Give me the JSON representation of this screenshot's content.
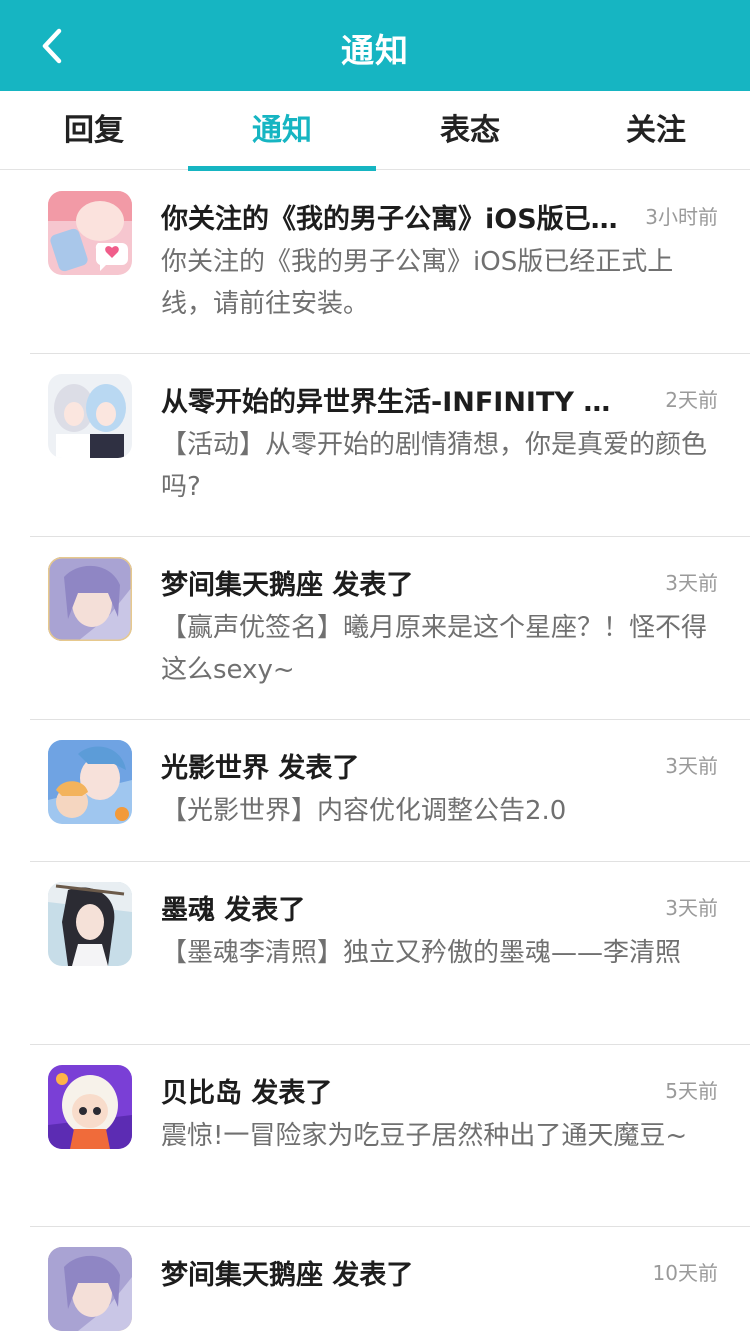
{
  "header": {
    "title": "通知"
  },
  "tabs": [
    {
      "label": "回复"
    },
    {
      "label": "通知"
    },
    {
      "label": "表态"
    },
    {
      "label": "关注"
    }
  ],
  "notifications": [
    {
      "title": "你关注的《我的男子公寓》iOS版已经正式上线",
      "time": "3小时前",
      "body": "你关注的《我的男子公寓》iOS版已经正式上线，请前往安装。"
    },
    {
      "title": "从零开始的异世界生活-INFINITY 发表了",
      "time": "2天前",
      "body": "【活动】从零开始的剧情猜想，你是真爱的颜色吗?"
    },
    {
      "title": "梦间集天鹅座 发表了",
      "time": "3天前",
      "body": "【赢声优签名】曦月原来是这个星座？！怪不得这么sexy~"
    },
    {
      "title": "光影世界 发表了",
      "time": "3天前",
      "body": "【光影世界】内容优化调整公告2.0"
    },
    {
      "title": "墨魂 发表了",
      "time": "3天前",
      "body": "【墨魂李清照】独立又矜傲的墨魂——李清照"
    },
    {
      "title": "贝比岛 发表了",
      "time": "5天前",
      "body": "震惊!一冒险家为吃豆子居然种出了通天魔豆~"
    },
    {
      "title": "梦间集天鹅座 发表了",
      "time": "10天前",
      "body": ""
    }
  ],
  "icons": {
    "back": "chevron-left-icon"
  },
  "colors": {
    "brand": "#16b5c2",
    "title_text": "#1d1d1d",
    "body_text": "#707070",
    "time_text": "#9a9a9a"
  }
}
